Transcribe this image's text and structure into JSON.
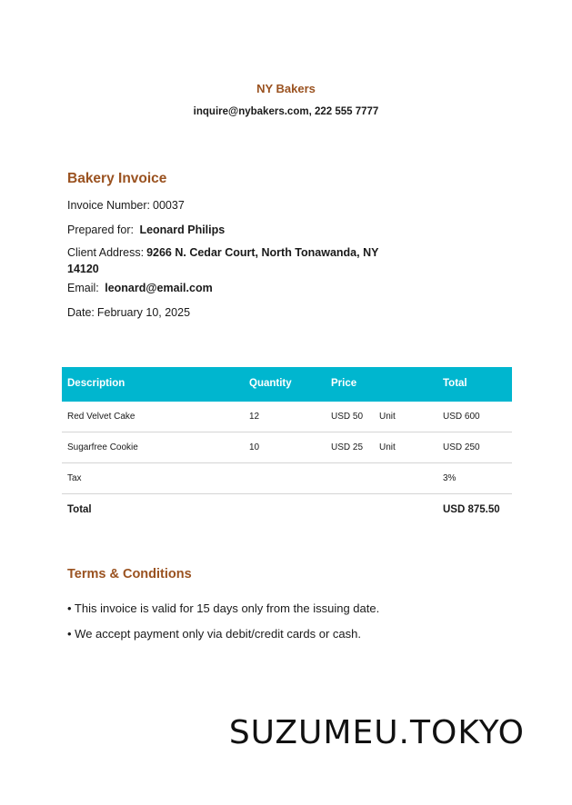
{
  "company": {
    "name": "NY Bakers",
    "contact": "inquire@nybakers.com, 222 555 7777"
  },
  "invoice": {
    "title": "Bakery Invoice",
    "number_label": "Invoice Number:",
    "number": "00037",
    "prepared_label": "Prepared for:",
    "prepared_for": "Leonard Philips",
    "address_label": "Client Address:",
    "address": "9266  N. Cedar Court, North Tonawanda,  NY 14120",
    "email_label": "Email:",
    "email": "leonard@email.com",
    "date_label": "Date:",
    "date": "February 10, 2025"
  },
  "table": {
    "headers": {
      "description": "Description",
      "quantity": "Quantity",
      "price": "Price",
      "total": "Total"
    },
    "rows": [
      {
        "description": "Red Velvet Cake",
        "quantity": "12",
        "price": "USD 50",
        "unit": "Unit",
        "total": "USD 600"
      },
      {
        "description": "Sugarfree Cookie",
        "quantity": "10",
        "price": "USD 25",
        "unit": "Unit",
        "total": "USD 250"
      }
    ],
    "tax": {
      "label": "Tax",
      "value": "3%"
    },
    "grand_total": {
      "label": "Total",
      "value": "USD 875.50"
    }
  },
  "terms": {
    "title": "Terms & Conditions",
    "items": [
      "• This invoice is valid for 15 days only from the issuing date.",
      "• We accept payment only via debit/credit cards or cash."
    ]
  },
  "watermark": "SUZUMEU.TOKYO",
  "colors": {
    "accent_brown": "#9a5220",
    "table_header": "#00b6cf"
  }
}
